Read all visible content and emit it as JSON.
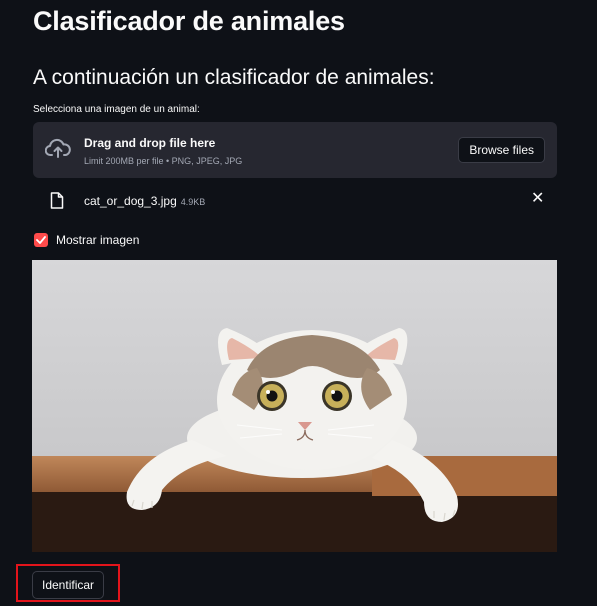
{
  "page": {
    "title": "Clasificador de animales",
    "subtitle": "A continuación un clasificador de animales:"
  },
  "uploader": {
    "label": "Selecciona una imagen de un animal:",
    "drop_title": "Drag and drop file here",
    "drop_hint": "Limit 200MB per file • PNG, JPEG, JPG",
    "browse_label": "Browse files",
    "icon": "cloud-upload-icon"
  },
  "file": {
    "name": "cat_or_dog_3.jpg",
    "size": "4.9KB",
    "icon": "file-icon",
    "remove_icon": "close-icon"
  },
  "show_image": {
    "label": "Mostrar imagen",
    "checked": true
  },
  "actions": {
    "identify_label": "Identificar"
  },
  "colors": {
    "background": "#0e1117",
    "dropzone": "#262730",
    "accent": "#ff4b4b",
    "highlight": "#e3141b"
  }
}
